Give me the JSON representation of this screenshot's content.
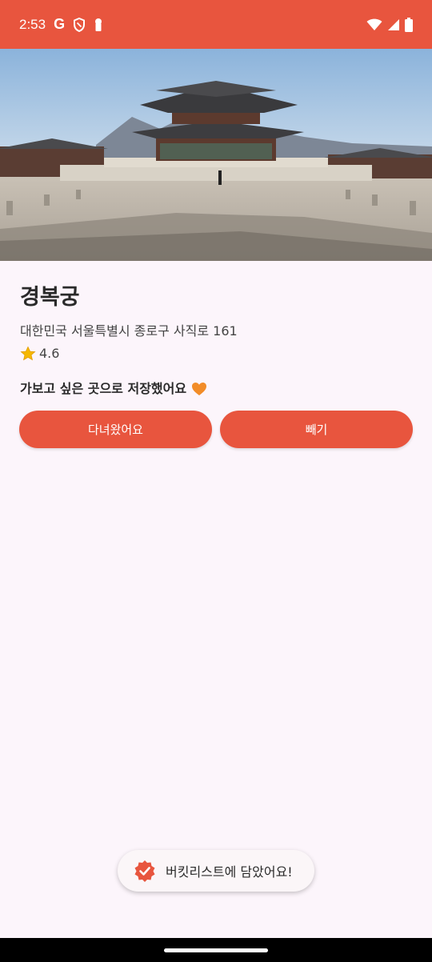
{
  "status_bar": {
    "time": "2:53",
    "google_letter": "G",
    "accent_color": "#e8553e"
  },
  "hero": {
    "image_desc_icon": "palace-photo"
  },
  "place": {
    "title": "경복궁",
    "address": "대한민국 서울특별시 종로구 사직로 161",
    "rating": "4.6",
    "saved_message": "가보고 싶은 곳으로 저장했어요"
  },
  "buttons": {
    "visited_label": "다녀왔어요",
    "remove_label": "빼기"
  },
  "toast": {
    "message": "버킷리스트에 담았어요!"
  },
  "colors": {
    "primary": "#e8553e",
    "background": "#fcf5fb",
    "heart": "#f28c28",
    "star": "#f5b800"
  }
}
